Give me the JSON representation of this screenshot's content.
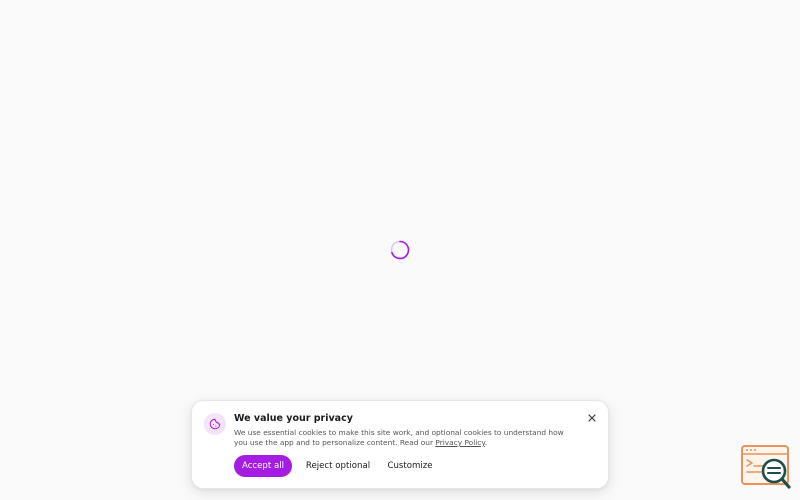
{
  "colors": {
    "accent": "#a51de0",
    "accent_light": "#f3e4fb",
    "background": "#fafafa",
    "widget_orange": "#e8935a",
    "widget_teal": "#1f4c4c"
  },
  "loading": {
    "icon": "loading-spinner-icon"
  },
  "cookie_banner": {
    "icon": "cookie-icon",
    "title": "We value your privacy",
    "text_before_link": "We use essential cookies to make this site work, and optional cookies to understand how you use the app and to personalize content. Read our ",
    "privacy_link": "Privacy Policy",
    "text_after_link": ".",
    "close_icon": "close-icon",
    "buttons": {
      "accept": "Accept all",
      "reject": "Reject optional",
      "customize": "Customize"
    }
  },
  "help_widget": {
    "icon": "help-search-icon"
  }
}
